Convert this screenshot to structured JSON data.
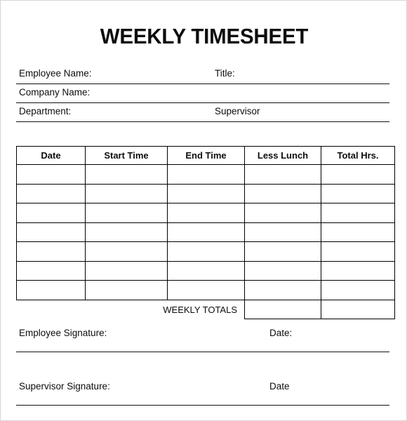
{
  "document": {
    "title": "WEEKLY TIMESHEET"
  },
  "header_fields": [
    {
      "label": "Employee Name:",
      "second_label": "Title:"
    },
    {
      "label": "Company Name:",
      "second_label": ""
    },
    {
      "label": "Department:",
      "second_label": "Supervisor"
    }
  ],
  "table": {
    "columns": [
      "Date",
      "Start Time",
      "End Time",
      "Less Lunch",
      "Total Hrs."
    ],
    "row_count": 7,
    "rows": [
      [
        "",
        "",
        "",
        "",
        ""
      ],
      [
        "",
        "",
        "",
        "",
        ""
      ],
      [
        "",
        "",
        "",
        "",
        ""
      ],
      [
        "",
        "",
        "",
        "",
        ""
      ],
      [
        "",
        "",
        "",
        "",
        ""
      ],
      [
        "",
        "",
        "",
        "",
        ""
      ],
      [
        "",
        "",
        "",
        "",
        ""
      ]
    ],
    "totals_row": {
      "label": "WEEKLY TOTALS",
      "less_lunch_total": "",
      "total_hrs_total": ""
    }
  },
  "signature_fields": [
    {
      "label": "Employee Signature:",
      "second_label": "Date:"
    },
    {
      "label": "Supervisor Signature:",
      "second_label": "Date"
    }
  ]
}
